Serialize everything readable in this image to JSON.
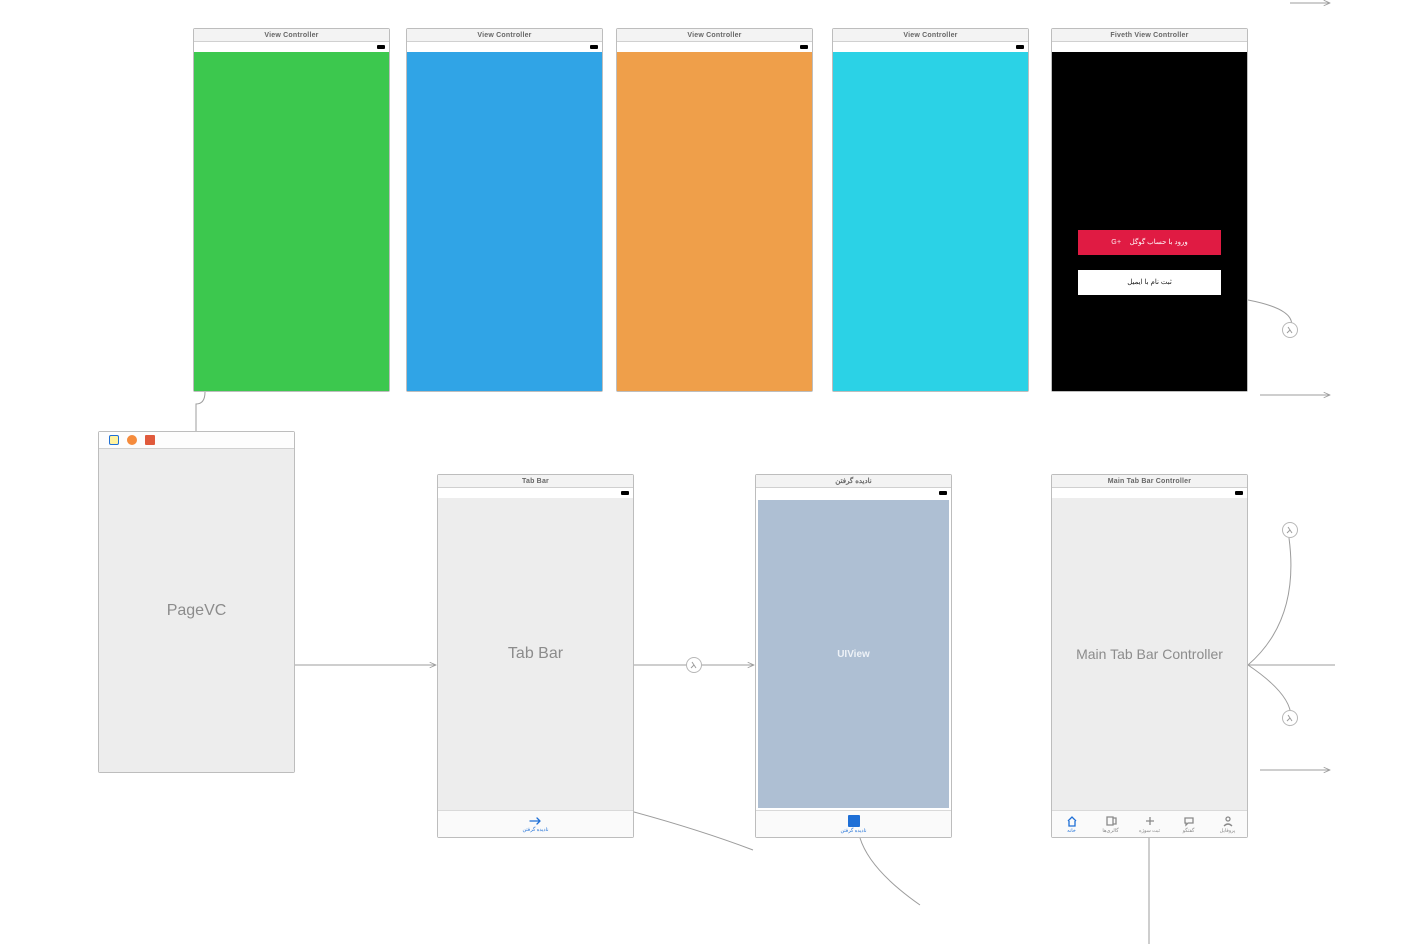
{
  "top": {
    "vc_title": "View Controller",
    "login_title": "Fiveth View Controller",
    "login": {
      "google": "ورود با حساب گوگل",
      "google_badge": "G+",
      "email": "ثبت نام با ایمیل"
    }
  },
  "pagevc": {
    "label": "PageVC"
  },
  "tabbar": {
    "title": "Tab Bar",
    "label": "Tab Bar",
    "tab_label": "نادیده گرفتن"
  },
  "unseen": {
    "title": "نادیده گرفتن",
    "view_label": "UIView",
    "tab_label": "نادیده گرفتن"
  },
  "maintab": {
    "title": "Main Tab Bar Controller",
    "label": "Main Tab Bar Controller",
    "tabs": [
      {
        "label": "خانه"
      },
      {
        "label": "گالری‌ها"
      },
      {
        "label": "ثبت سوژه"
      },
      {
        "label": "گفتگو"
      },
      {
        "label": "پروفایل"
      }
    ]
  }
}
